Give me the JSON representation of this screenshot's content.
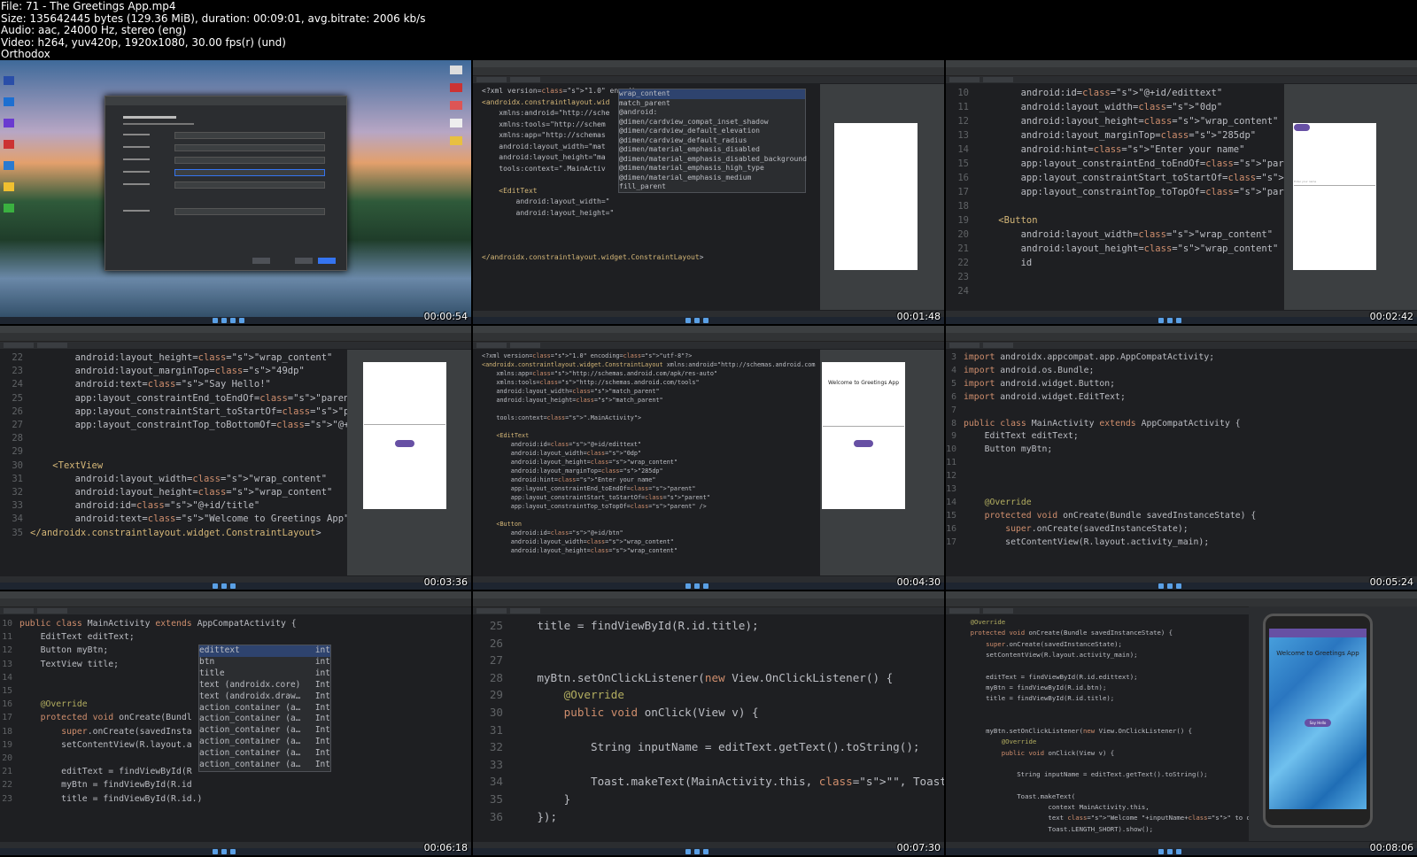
{
  "header": {
    "file": "File: 71 - The Greetings App.mp4",
    "size": "Size: 135642445 bytes (129.36 MiB), duration: 00:09:01, avg.bitrate: 2006 kb/s",
    "audio": "Audio: aac, 24000 Hz, stereo (eng)",
    "video": "Video: h264, yuv420p, 1920x1080, 30.00 fps(r) (und)",
    "brand": "Orthodox"
  },
  "thumbs": [
    {
      "time": "00:00:54"
    },
    {
      "time": "00:01:48"
    },
    {
      "time": "00:02:42"
    },
    {
      "time": "00:03:36"
    },
    {
      "time": "00:04:30"
    },
    {
      "time": "00:05:24"
    },
    {
      "time": "00:06:18"
    },
    {
      "time": "00:07:30"
    },
    {
      "time": "00:08:06"
    }
  ],
  "t2": {
    "lines": [
      "<?xml version=\"1.0\" encoding=",
      "<androidx.constraintlayout.wid",
      "    xmlns:android=\"http://sche",
      "    xmlns:tools=\"http://schem",
      "    xmlns:app=\"http://schemas",
      "    android:layout_width=\"mat",
      "    android:layout_height=\"ma",
      "    tools:context=\".MainActiv",
      "",
      "    <EditText",
      "        android:layout_width=\"",
      "        android:layout_height=\"",
      "",
      "",
      "",
      "</androidx.constraintlayout.widget.ConstraintLayout>"
    ],
    "popup": [
      "wrap_content",
      "match_parent",
      "@android:",
      "@dimen/cardview_compat_inset_shadow",
      "@dimen/cardview_default_elevation",
      "@dimen/cardview_default_radius",
      "@dimen/material_emphasis_disabled",
      "@dimen/material_emphasis_disabled_background",
      "@dimen/material_emphasis_high_type",
      "@dimen/material_emphasis_medium",
      "fill_parent"
    ]
  },
  "t3": {
    "nums": [
      "10",
      "11",
      "12",
      "13",
      "14",
      "15",
      "16",
      "17",
      "18",
      "19",
      "20",
      "21",
      "22",
      "23",
      "24"
    ],
    "lines": [
      "        android:id=\"@+id/edittext\"",
      "        android:layout_width=\"0dp\"",
      "        android:layout_height=\"wrap_content\"",
      "        android:layout_marginTop=\"285dp\"",
      "        android:hint=\"Enter your name\"",
      "        app:layout_constraintEnd_toEndOf=\"parent\"",
      "        app:layout_constraintStart_toStartOf=\"parent\"",
      "        app:layout_constraintTop_toTopOf=\"parent\" />",
      "",
      "    <Button",
      "        android:layout_width=\"wrap_content\"",
      "        android:layout_height=\"wrap_content\"",
      "        id",
      "",
      ""
    ],
    "hint": "Enter your name"
  },
  "t4": {
    "nums": [
      "22",
      "23",
      "24",
      "25",
      "26",
      "27",
      "28",
      "29",
      "30",
      "31",
      "32",
      "33",
      "34",
      "35"
    ],
    "lines": [
      "        android:layout_height=\"wrap_content\"",
      "        android:layout_marginTop=\"49dp\"",
      "        android:text=\"Say Hello!\"",
      "        app:layout_constraintEnd_toEndOf=\"parent\"",
      "        app:layout_constraintStart_toStartOf=\"parent\"",
      "        app:layout_constraintTop_toBottomOf=\"@+id/edittext\"",
      "",
      "",
      "    <TextView",
      "        android:layout_width=\"wrap_content\"",
      "        android:layout_height=\"wrap_content\"",
      "        android:id=\"@+id/title\"",
      "        android:text=\"Welcome to Greetings App\"/>",
      "</androidx.constraintlayout.widget.ConstraintLayout>"
    ]
  },
  "t5": {
    "lines": [
      "<?xml version=\"1.0\" encoding=\"utf-8\"?>",
      "<androidx.constraintlayout.widget.ConstraintLayout xmlns:android=\"http://schemas.android.com",
      "    xmlns:app=\"http://schemas.android.com/apk/res-auto\"",
      "    xmlns:tools=\"http://schemas.android.com/tools\"",
      "    android:layout_width=\"match_parent\"",
      "    android:layout_height=\"match_parent\"",
      "",
      "    tools:context=\".MainActivity\">",
      "",
      "    <EditText",
      "        android:id=\"@+id/edittext\"",
      "        android:layout_width=\"0dp\"",
      "        android:layout_height=\"wrap_content\"",
      "        android:layout_marginTop=\"285dp\"",
      "        android:hint=\"Enter your name\"",
      "        app:layout_constraintEnd_toEndOf=\"parent\"",
      "        app:layout_constraintStart_toStartOf=\"parent\"",
      "        app:layout_constraintTop_toTopOf=\"parent\" />",
      "",
      "    <Button",
      "        android:id=\"@+id/btn\"",
      "        android:layout_width=\"wrap_content\"",
      "        android:layout_height=\"wrap_content\""
    ],
    "welcome": "Welcome to Greetings App"
  },
  "t6": {
    "nums": [
      "3",
      "4",
      "5",
      "6",
      "7",
      "8",
      "9",
      "10",
      "11",
      "12",
      "13",
      "14",
      "15",
      "16",
      "17"
    ],
    "lines": [
      "import androidx.appcompat.app.AppCompatActivity;",
      "import android.os.Bundle;",
      "import android.widget.Button;",
      "import android.widget.EditText;",
      "",
      "public class MainActivity extends AppCompatActivity {",
      "    EditText editText;",
      "    Button myBtn;",
      "",
      "",
      "",
      "    @Override",
      "    protected void onCreate(Bundle savedInstanceState) {",
      "        super.onCreate(savedInstanceState);",
      "        setContentView(R.layout.activity_main);"
    ]
  },
  "t7": {
    "nums": [
      "10",
      "11",
      "12",
      "13",
      "14",
      "15",
      "16",
      "17",
      "18",
      "19",
      "20",
      "21",
      "22",
      "23"
    ],
    "lines": [
      "public class MainActivity extends AppCompatActivity {",
      "    EditText editText;",
      "    Button myBtn;",
      "    TextView title;",
      "",
      "",
      "    @Override",
      "    protected void onCreate(Bundl",
      "        super.onCreate(savedInsta",
      "        setContentView(R.layout.a",
      "",
      "        editText = findViewById(R",
      "        myBtn = findViewById(R.id",
      "        title = findViewById(R.id.)"
    ],
    "popup": [
      [
        "edittext",
        "int"
      ],
      [
        "btn",
        "int"
      ],
      [
        "title",
        "int"
      ],
      [
        "text (androidx.core)",
        "Int"
      ],
      [
        "text (androidx.draw…",
        "Int"
      ],
      [
        "action_container (a…",
        "Int"
      ],
      [
        "action_container (a…",
        "Int"
      ],
      [
        "action_container (a…",
        "Int"
      ],
      [
        "action_container (a…",
        "Int"
      ],
      [
        "action_container (a…",
        "Int"
      ],
      [
        "action_container (a…",
        "Int"
      ]
    ]
  },
  "t8": {
    "nums": [
      "25",
      "26",
      "27",
      "28",
      "29",
      "30",
      "31",
      "32",
      "33",
      "34",
      "35",
      "36"
    ],
    "lines": [
      "    title = findViewById(R.id.title);",
      "",
      "",
      "    myBtn.setOnClickListener(new View.OnClickListener() {",
      "        @Override",
      "        public void onClick(View v) {",
      "",
      "            String inputName = editText.getText().toString();",
      "",
      "            Toast.makeText(MainActivity.this, \"\", Toast.LENGTH_S",
      "        }",
      "    });"
    ]
  },
  "t9": {
    "lines": [
      "    @Override",
      "    protected void onCreate(Bundle savedInstanceState) {",
      "        super.onCreate(savedInstanceState);",
      "        setContentView(R.layout.activity_main);",
      "",
      "        editText = findViewById(R.id.edittext);",
      "        myBtn = findViewById(R.id.btn);",
      "        title = findViewById(R.id.title);",
      "",
      "",
      "        myBtn.setOnClickListener(new View.OnClickListener() {",
      "            @Override",
      "            public void onClick(View v) {",
      "",
      "                String inputName = editText.getText().toString();",
      "",
      "                Toast.makeText(",
      "                        context MainActivity.this,",
      "                        text \"Welcome \"+inputName+\" to our App\",",
      "                        Toast.LENGTH_SHORT).show();"
    ],
    "welcome": "Welcome to Greetings App",
    "button": "Say Hello"
  }
}
